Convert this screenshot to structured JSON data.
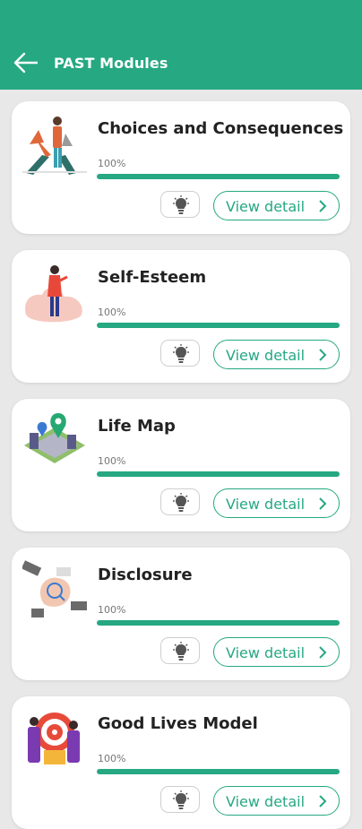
{
  "header": {
    "title": "PAST Modules",
    "back_icon": "arrow-left-icon",
    "color": "#26a882"
  },
  "modules": [
    {
      "title": "Choices and Consequences",
      "progress_label": "100%",
      "progress": 1.0,
      "image": "crossroads-illustration",
      "tip_icon": "lightbulb-icon",
      "detail_label": "View detail",
      "chevron": "chevron-right-icon"
    },
    {
      "title": "Self-Esteem",
      "progress_label": "100%",
      "progress": 1.0,
      "image": "woman-reflection-illustration",
      "tip_icon": "lightbulb-icon",
      "detail_label": "View detail",
      "chevron": "chevron-right-icon"
    },
    {
      "title": "Life Map",
      "progress_label": "100%",
      "progress": 1.0,
      "image": "map-pin-illustration",
      "tip_icon": "lightbulb-icon",
      "detail_label": "View detail",
      "chevron": "chevron-right-icon"
    },
    {
      "title": "Disclosure",
      "progress_label": "100%",
      "progress": 1.0,
      "image": "handshake-illustration",
      "tip_icon": "lightbulb-icon",
      "detail_label": "View detail",
      "chevron": "chevron-right-icon"
    },
    {
      "title": "Good Lives Model",
      "progress_label": "100%",
      "progress": 1.0,
      "image": "target-goal-illustration",
      "tip_icon": "lightbulb-icon",
      "detail_label": "View detail",
      "chevron": "chevron-right-icon"
    }
  ],
  "colors": {
    "accent": "#26a882",
    "background": "#e8e8e8",
    "card": "#ffffff"
  }
}
